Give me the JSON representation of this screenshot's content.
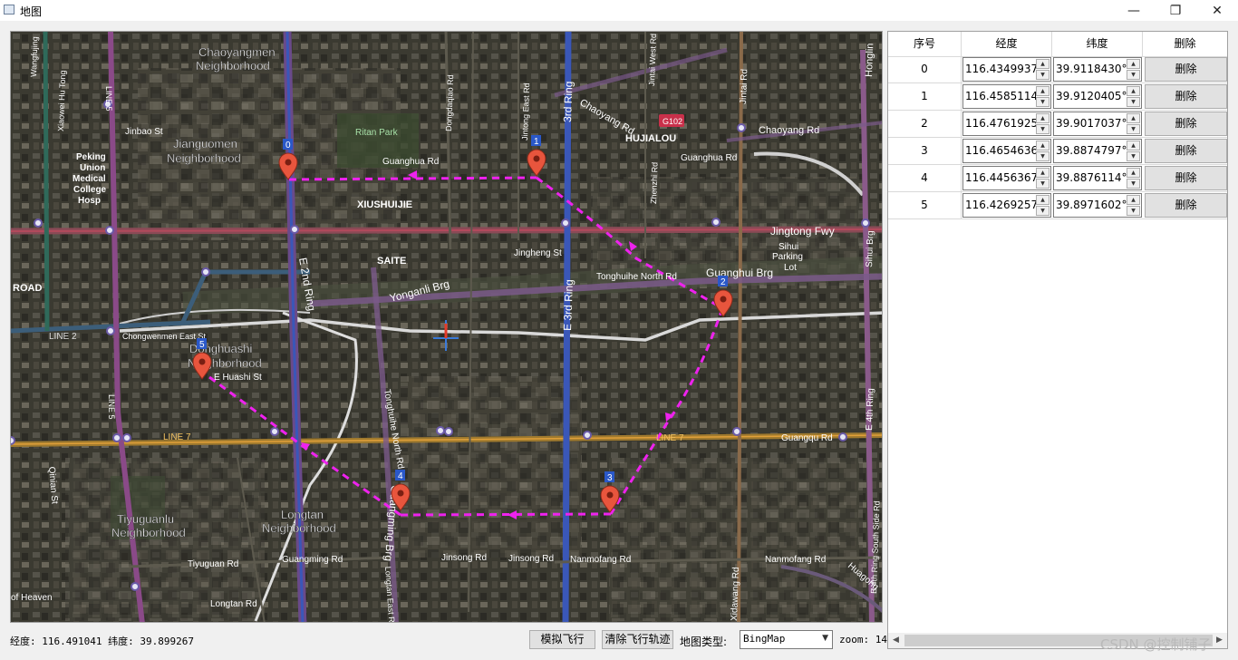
{
  "window": {
    "title": "地图",
    "minimize": "—",
    "maximize": "❐",
    "close": "✕"
  },
  "table": {
    "headers": [
      "序号",
      "经度",
      "纬度",
      "删除"
    ],
    "rows": [
      {
        "index": "0",
        "lon": "116.4349937°",
        "lat": "39.9118430°",
        "delete": "删除"
      },
      {
        "index": "1",
        "lon": "116.4585114°",
        "lat": "39.9120405°",
        "delete": "删除"
      },
      {
        "index": "2",
        "lon": "116.4761925°",
        "lat": "39.9017037°",
        "delete": "删除"
      },
      {
        "index": "3",
        "lon": "116.4654636°",
        "lat": "39.8874797°",
        "delete": "删除"
      },
      {
        "index": "4",
        "lon": "116.4456367°",
        "lat": "39.8876114°",
        "delete": "删除"
      },
      {
        "index": "5",
        "lon": "116.4269257°",
        "lat": "39.8971602°",
        "delete": "删除"
      }
    ]
  },
  "status": {
    "coords": "经度: 116.491041 纬度: 39.899267"
  },
  "toolbar": {
    "simulate": "模拟飞行",
    "clear": "清除飞行轨迹",
    "map_type_label": "地图类型:",
    "map_type_value": "BingMap",
    "zoom": "zoom: 14"
  },
  "watermark": "CSDN @控制铺子",
  "map": {
    "markers": [
      {
        "label": "0"
      },
      {
        "label": "1"
      },
      {
        "label": "2"
      },
      {
        "label": "3"
      },
      {
        "label": "4"
      },
      {
        "label": "5"
      }
    ],
    "labels": [
      {
        "text": "Chaoyangmen"
      },
      {
        "text": "Neighborhood"
      },
      {
        "text": "Jianguomen"
      },
      {
        "text": "Neighborhood"
      },
      {
        "text": "Peking"
      },
      {
        "text": "Union"
      },
      {
        "text": "Medical"
      },
      {
        "text": "College"
      },
      {
        "text": "Hosp"
      },
      {
        "text": "Jinbao St"
      },
      {
        "text": "Ritan Park"
      },
      {
        "text": "Guanghua Rd"
      },
      {
        "text": "XIUSHUIJIE"
      },
      {
        "text": "SAITE"
      },
      {
        "text": "HUJIALOU"
      },
      {
        "text": "Guanghua Rd"
      },
      {
        "text": "Chaoyang Rd"
      },
      {
        "text": "Chaoyang Rd"
      },
      {
        "text": "G102"
      },
      {
        "text": "Jingtong Fwy"
      },
      {
        "text": "Sihui"
      },
      {
        "text": "Parking"
      },
      {
        "text": "Lot"
      },
      {
        "text": "Guanghui Brg"
      },
      {
        "text": "Tonghuihe North Rd"
      },
      {
        "text": "Jingheng St"
      },
      {
        "text": "Yonganli Brg"
      },
      {
        "text": "E 2nd Ring"
      },
      {
        "text": "E 3rd Ring"
      },
      {
        "text": "3rd Ring"
      },
      {
        "text": "ROAD"
      },
      {
        "text": "LINE 2"
      },
      {
        "text": "Chongwenmen East St"
      },
      {
        "text": "Donghuashi"
      },
      {
        "text": "Neighborhood"
      },
      {
        "text": "E Huashi St"
      },
      {
        "text": "LINE 7"
      },
      {
        "text": "LINE 7"
      },
      {
        "text": "Guangqu Rd"
      },
      {
        "text": "Tiyuguanlu"
      },
      {
        "text": "Neighborhood"
      },
      {
        "text": "Longtan"
      },
      {
        "text": "Neighborhood"
      },
      {
        "text": "Tiyuguan Rd"
      },
      {
        "text": "Guangming Rd"
      },
      {
        "text": "Jinsong Rd"
      },
      {
        "text": "Jinsong Rd"
      },
      {
        "text": "Nanmofang Rd"
      },
      {
        "text": "Nanmofang Rd"
      },
      {
        "text": "Longtan Rd"
      },
      {
        "text": "of Heaven"
      },
      {
        "text": "Xidawang Rd"
      },
      {
        "text": "E 4th Ring"
      },
      {
        "text": "Sihui Brg"
      },
      {
        "text": "Honglin"
      },
      {
        "text": "Jintai Rd"
      },
      {
        "text": "Guangqu Rd"
      },
      {
        "text": "Huagong"
      },
      {
        "text": "E 4th Ring South Side Rd"
      },
      {
        "text": "Qinian St"
      },
      {
        "text": "Dongdaqiao Rd"
      },
      {
        "text": "Jintong East Rd"
      },
      {
        "text": "Jintai West Rd"
      },
      {
        "text": "Zhenzhi Rd"
      },
      {
        "text": "Tonghuihe North Rd"
      },
      {
        "text": "Longtan East Rd"
      },
      {
        "text": "Guangming Brg"
      },
      {
        "text": "Xiaowei Hu Tong"
      },
      {
        "text": "Wangfujing"
      },
      {
        "text": "LINE 5"
      },
      {
        "text": "LINE 5"
      },
      {
        "text": "Chaoyangmen"
      },
      {
        "text": "Jingtong Fwy"
      }
    ]
  }
}
